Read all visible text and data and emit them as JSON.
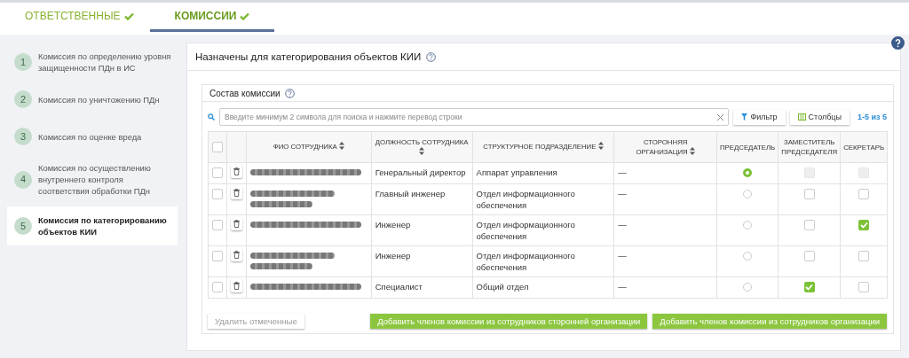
{
  "tabs": [
    {
      "label": "ОТВЕТСТВЕННЫЕ",
      "done": true,
      "selected": false
    },
    {
      "label": "КОМИССИИ",
      "done": true,
      "selected": true
    }
  ],
  "sidebar": {
    "items": [
      {
        "number": "1",
        "label": "Комиссия по определению уровня защищенности ПДн в ИС",
        "selected": false
      },
      {
        "number": "2",
        "label": "Комиссия по уничтожению ПДн",
        "selected": false
      },
      {
        "number": "3",
        "label": "Комиссия по оценке вреда",
        "selected": false
      },
      {
        "number": "4",
        "label": "Комиссия по осуществлению внутреннего контроля соответствия обработки ПДн",
        "selected": false
      },
      {
        "number": "5",
        "label": "Комиссия по категорированию объектов КИИ",
        "selected": true
      }
    ]
  },
  "panel": {
    "title": "Назначены для категорирования объектов КИИ",
    "card": {
      "title": "Состав комиссии",
      "search": {
        "placeholder": "Введите минимум 2 символа для поиска и нажмите перевод строки"
      },
      "filter_button": "Фильтр",
      "columns_button": "Столбцы",
      "pagination": "1-5 из 5",
      "table": {
        "all_checked": false,
        "columns": [
          {
            "label": "ФИО СОТРУДНИКА",
            "sortable": true
          },
          {
            "label": "ДОЛЖНОСТЬ СОТРУДНИКА",
            "sortable": true
          },
          {
            "label": "СТРУКТУРНОЕ ПОДРАЗДЕЛЕНИЕ",
            "sortable": true
          },
          {
            "label": "СТОРОННЯЯ ОРГАНИЗАЦИЯ",
            "sortable": true
          },
          {
            "label": "ПРЕДСЕДАТЕЛЬ",
            "sortable": false
          },
          {
            "label": "ЗАМЕСТИТЕЛЬ ПРЕДСЕДАТЕЛЯ",
            "sortable": false
          },
          {
            "label": "СЕКРЕТАРЬ",
            "sortable": false
          }
        ],
        "rows": [
          {
            "checked": false,
            "name": {
              "kind": "blurred",
              "wrapped": false
            },
            "position": "Генеральный директор",
            "department": "Аппарат управления",
            "organization": "—",
            "chairman": {
              "selected": true
            },
            "deputy": {
              "checked": false,
              "disabled": true
            },
            "secretary": {
              "checked": false,
              "disabled": true
            }
          },
          {
            "checked": false,
            "name": {
              "kind": "blurred",
              "wrapped": true
            },
            "position": "Главный инженер",
            "department": "Отдел информационного обеспечения",
            "organization": "—",
            "chairman": {
              "selected": false
            },
            "deputy": {
              "checked": false,
              "disabled": false
            },
            "secretary": {
              "checked": false,
              "disabled": false
            }
          },
          {
            "checked": false,
            "name": {
              "kind": "blurred",
              "wrapped": false
            },
            "position": "Инженер",
            "department": "Отдел информационного обеспечения",
            "organization": "—",
            "chairman": {
              "selected": false
            },
            "deputy": {
              "checked": false,
              "disabled": false
            },
            "secretary": {
              "checked": true,
              "disabled": false
            }
          },
          {
            "checked": false,
            "name": {
              "kind": "blurred",
              "wrapped": true
            },
            "position": "Инженер",
            "department": "Отдел информационного обеспечения",
            "organization": "—",
            "chairman": {
              "selected": false
            },
            "deputy": {
              "checked": false,
              "disabled": false
            },
            "secretary": {
              "checked": false,
              "disabled": false
            }
          },
          {
            "checked": false,
            "name": {
              "kind": "blurred",
              "wrapped": false
            },
            "position": "Специалист",
            "department": "Общий отдел",
            "organization": "—",
            "chairman": {
              "selected": false
            },
            "deputy": {
              "checked": true,
              "disabled": false
            },
            "secretary": {
              "checked": false,
              "disabled": false
            }
          }
        ]
      },
      "buttons": [
        {
          "label": "Удалить отмеченные",
          "kind": "plain",
          "disabled": true
        },
        {
          "label": "Добавить членов комиссии из сотрудников сторонней организации",
          "kind": "primary",
          "disabled": false
        },
        {
          "label": "Добавить членов комиссии из сотрудников организации",
          "kind": "primary",
          "disabled": false
        }
      ]
    }
  }
}
